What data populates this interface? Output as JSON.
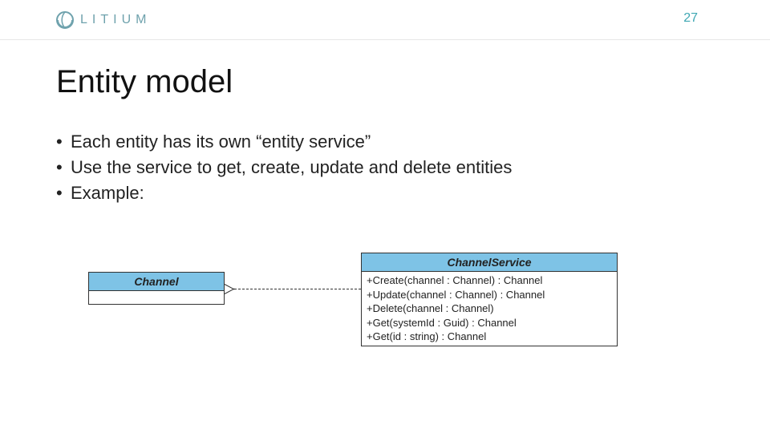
{
  "header": {
    "brand": "LITIUM",
    "page_number": "27"
  },
  "title": "Entity model",
  "bullets": [
    "Each entity has its own “entity service”",
    "Use the service to get, create, update and delete entities",
    "Example:"
  ],
  "diagram": {
    "left_class": {
      "name": "Channel",
      "members": []
    },
    "right_class": {
      "name": "ChannelService",
      "members": [
        "+Create(channel : Channel) : Channel",
        "+Update(channel : Channel) : Channel",
        "+Delete(channel : Channel)",
        "+Get(systemId : Guid) : Channel",
        "+Get(id : string) : Channel"
      ]
    },
    "relation": "dependency-arrow-left"
  }
}
